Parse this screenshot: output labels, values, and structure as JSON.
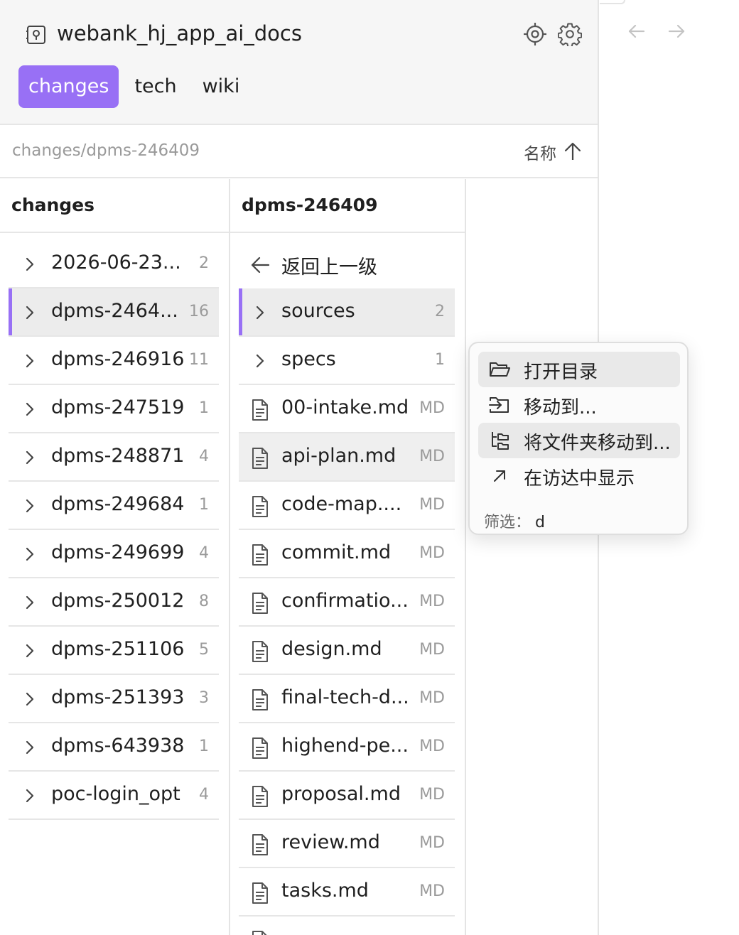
{
  "vault": {
    "name": "webank_hj_app_ai_docs",
    "icon": "vault-icon"
  },
  "header_icons": [
    "locate-icon",
    "gear-icon"
  ],
  "tabs": [
    {
      "label": "changes",
      "active": true
    },
    {
      "label": "tech",
      "active": false
    },
    {
      "label": "wiki",
      "active": false
    }
  ],
  "pathbar": {
    "path": "changes/dpms-246409",
    "sort_label": "名称",
    "sort_icon": "sort-ascending-arrow-icon"
  },
  "columns": [
    {
      "title": "changes",
      "rows": [
        {
          "label": "2026-06-23...",
          "count": "2"
        },
        {
          "label": "dpms-2464...",
          "count": "16"
        },
        {
          "label": "dpms-246916",
          "count": "11"
        },
        {
          "label": "dpms-247519",
          "count": "1"
        },
        {
          "label": "dpms-248871",
          "count": "4"
        },
        {
          "label": "dpms-249684",
          "count": "1"
        },
        {
          "label": "dpms-249699",
          "count": "4"
        },
        {
          "label": "dpms-250012",
          "count": "8"
        },
        {
          "label": "dpms-251106",
          "count": "5"
        },
        {
          "label": "dpms-251393",
          "count": "3"
        },
        {
          "label": "dpms-643938",
          "count": "1"
        },
        {
          "label": "poc-login_opt",
          "count": "4"
        }
      ]
    },
    {
      "title": "dpms-246409",
      "back_label": "返回上一级",
      "rows": [
        {
          "label": "sources",
          "count": "2"
        },
        {
          "label": "specs",
          "count": "1"
        },
        {
          "label": "00-intake.md",
          "count": "MD"
        },
        {
          "label": "api-plan.md",
          "count": "MD"
        },
        {
          "label": "code-map....",
          "count": "MD"
        },
        {
          "label": "commit.md",
          "count": "MD"
        },
        {
          "label": "confirmatio...",
          "count": "MD"
        },
        {
          "label": "design.md",
          "count": "MD"
        },
        {
          "label": "final-tech-d...",
          "count": "MD"
        },
        {
          "label": "highend-pe...",
          "count": "MD"
        },
        {
          "label": "proposal.md",
          "count": "MD"
        },
        {
          "label": "review.md",
          "count": "MD"
        },
        {
          "label": "tasks.md",
          "count": "MD"
        },
        {
          "label": "",
          "count": ""
        }
      ]
    }
  ],
  "nav": {
    "back_icon": "arrow-left-icon",
    "forward_icon": "arrow-right-icon"
  },
  "context_menu": {
    "items": [
      {
        "label": "打开目录",
        "icon": "folder-open-icon"
      },
      {
        "label": "移动到...",
        "icon": "move-to-icon"
      },
      {
        "label": "将文件夹移动到...",
        "icon": "move-folder-icon"
      },
      {
        "label": "在访达中显示",
        "icon": "reveal-arrow-icon"
      }
    ],
    "filter_label": "筛选：",
    "filter_value": "d"
  },
  "colors": {
    "accent": "#9870f5",
    "selected_row": "#ececec",
    "header_bg": "#f6f6f6"
  }
}
